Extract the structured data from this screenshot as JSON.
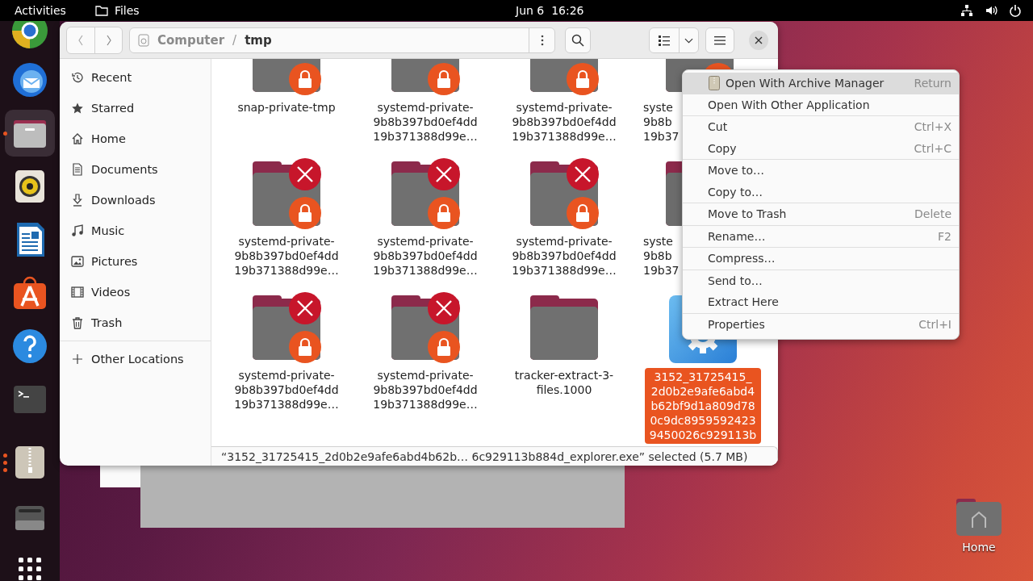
{
  "top_bar": {
    "activities": "Activities",
    "app": "Files",
    "clock": "Jun 6  16:26"
  },
  "dock": [
    {
      "kind": "browser",
      "running": false,
      "focused": false
    },
    {
      "kind": "mail",
      "running": false,
      "focused": false
    },
    {
      "kind": "files",
      "running": true,
      "multiple_windows": false,
      "focused": true
    },
    {
      "kind": "music",
      "running": false,
      "focused": false
    },
    {
      "kind": "writer",
      "running": false,
      "focused": false
    },
    {
      "kind": "store",
      "running": false,
      "focused": false
    },
    {
      "kind": "help",
      "running": false,
      "focused": false
    },
    {
      "kind": "terminal",
      "running": false,
      "focused": false
    },
    {
      "kind": "archive",
      "running": true,
      "multiple_windows": true,
      "focused": false
    },
    {
      "kind": "drive",
      "running": false,
      "focused": false
    },
    {
      "kind": "apps",
      "running": false,
      "focused": false
    }
  ],
  "files_window": {
    "path": [
      {
        "label": "Computer",
        "current": false
      },
      {
        "label": "tmp",
        "current": true
      }
    ],
    "path_separator": "/",
    "sidebar": [
      {
        "label": "Recent"
      },
      {
        "label": "Starred"
      },
      {
        "label": "Home"
      },
      {
        "label": "Documents"
      },
      {
        "label": "Downloads"
      },
      {
        "label": "Music"
      },
      {
        "label": "Pictures"
      },
      {
        "label": "Videos"
      },
      {
        "label": "Trash"
      }
    ],
    "other_locations": "Other Locations",
    "items": [
      {
        "kind": "folder",
        "lines": [
          "snap-private-tmp"
        ],
        "denied": false,
        "locked": true,
        "covered": false,
        "selected": false
      },
      {
        "kind": "folder",
        "lines": [
          "systemd-private-",
          "9b8b397bd0ef4dd",
          "19b371388d99e…"
        ],
        "denied": false,
        "locked": true,
        "covered": false,
        "selected": false
      },
      {
        "kind": "folder",
        "lines": [
          "systemd-private-",
          "9b8b397bd0ef4dd",
          "19b371388d99e…"
        ],
        "denied": false,
        "locked": true,
        "covered": false,
        "selected": false
      },
      {
        "kind": "folder",
        "lines": [
          "syste",
          "9b8b",
          "19b37"
        ],
        "denied": false,
        "locked": true,
        "covered": true,
        "selected": false
      },
      {
        "kind": "folder",
        "lines": [
          "systemd-private-",
          "9b8b397bd0ef4dd",
          "19b371388d99e…"
        ],
        "denied": true,
        "locked": true,
        "covered": false,
        "selected": false
      },
      {
        "kind": "folder",
        "lines": [
          "systemd-private-",
          "9b8b397bd0ef4dd",
          "19b371388d99e…"
        ],
        "denied": true,
        "locked": true,
        "covered": false,
        "selected": false
      },
      {
        "kind": "folder",
        "lines": [
          "systemd-private-",
          "9b8b397bd0ef4dd",
          "19b371388d99e…"
        ],
        "denied": true,
        "locked": true,
        "covered": false,
        "selected": false
      },
      {
        "kind": "folder",
        "lines": [
          "syste",
          "9b8b",
          "19b37"
        ],
        "denied": false,
        "locked": false,
        "covered": true,
        "selected": false
      },
      {
        "kind": "folder",
        "lines": [
          "systemd-private-",
          "9b8b397bd0ef4dd",
          "19b371388d99e…"
        ],
        "denied": true,
        "locked": true,
        "covered": false,
        "selected": false
      },
      {
        "kind": "folder",
        "lines": [
          "systemd-private-",
          "9b8b397bd0ef4dd",
          "19b371388d99e…"
        ],
        "denied": true,
        "locked": true,
        "covered": false,
        "selected": false
      },
      {
        "kind": "folder",
        "lines": [
          "tracker-extract-3-",
          "files.1000"
        ],
        "denied": false,
        "locked": false,
        "covered": false,
        "selected": false
      },
      {
        "kind": "executable",
        "lines": [
          "3152_31725415_",
          "2d0b2e9afe6abd4",
          "b62bf9d1a809d78",
          "0c9dc8959592423",
          "9450026c929113b"
        ],
        "denied": false,
        "locked": false,
        "covered": false,
        "selected": true
      }
    ],
    "status": "“3152_31725415_2d0b2e9afe6abd4b62b… 6c929113b884d_explorer.exe” selected (5.7 MB)"
  },
  "context_menu": {
    "groups": [
      [
        {
          "label": "Open With Archive Manager",
          "shortcut": "Return",
          "icon": true,
          "selected": true
        },
        {
          "label": "Open With Other Application",
          "icon": false,
          "selected": false
        }
      ],
      [
        {
          "label": "Cut",
          "shortcut": "Ctrl+X",
          "icon": false,
          "selected": false
        },
        {
          "label": "Copy",
          "shortcut": "Ctrl+C",
          "icon": false,
          "selected": false
        }
      ],
      [
        {
          "label": "Move to…",
          "icon": false,
          "selected": false
        },
        {
          "label": "Copy to…",
          "icon": false,
          "selected": false
        }
      ],
      [
        {
          "label": "Move to Trash",
          "shortcut": "Delete",
          "icon": false,
          "selected": false
        }
      ],
      [
        {
          "label": "Rename…",
          "shortcut": "F2",
          "icon": false,
          "selected": false
        }
      ],
      [
        {
          "label": "Compress…",
          "icon": false,
          "selected": false
        }
      ],
      [
        {
          "label": "Send to…",
          "icon": false,
          "selected": false
        },
        {
          "label": "Extract Here",
          "icon": false,
          "selected": false
        }
      ],
      [
        {
          "label": "Properties",
          "shortcut": "Ctrl+I",
          "icon": false,
          "selected": false
        }
      ]
    ]
  },
  "desktop_icons": [
    {
      "label": "Home"
    }
  ]
}
